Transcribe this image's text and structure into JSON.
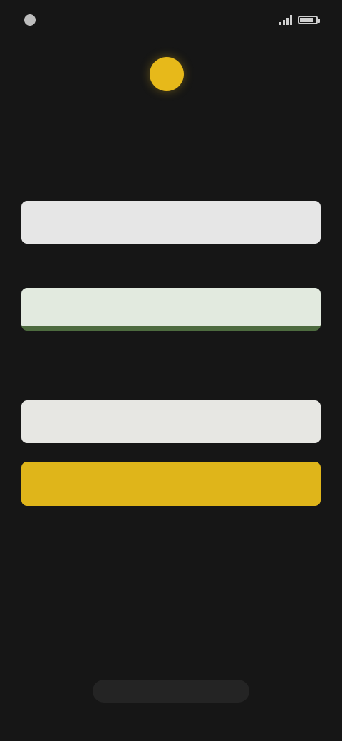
{
  "status_bar": {
    "time": "",
    "battery_level": 0.8
  },
  "brand": {
    "wordmark": "",
    "coin_color": "#e7b91a"
  },
  "subtitle": "",
  "form": {
    "username_label": "",
    "username_value": "",
    "password_label": "",
    "password_value": "",
    "helper_text": "",
    "code_label": "",
    "code_value": ""
  },
  "actions": {
    "primary_label": "",
    "secondary_label": "",
    "divider_text": "",
    "footer_label": ""
  },
  "colors": {
    "background": "#161616",
    "accent": "#dfb51a",
    "field_focus_border": "#4d6b3f"
  }
}
